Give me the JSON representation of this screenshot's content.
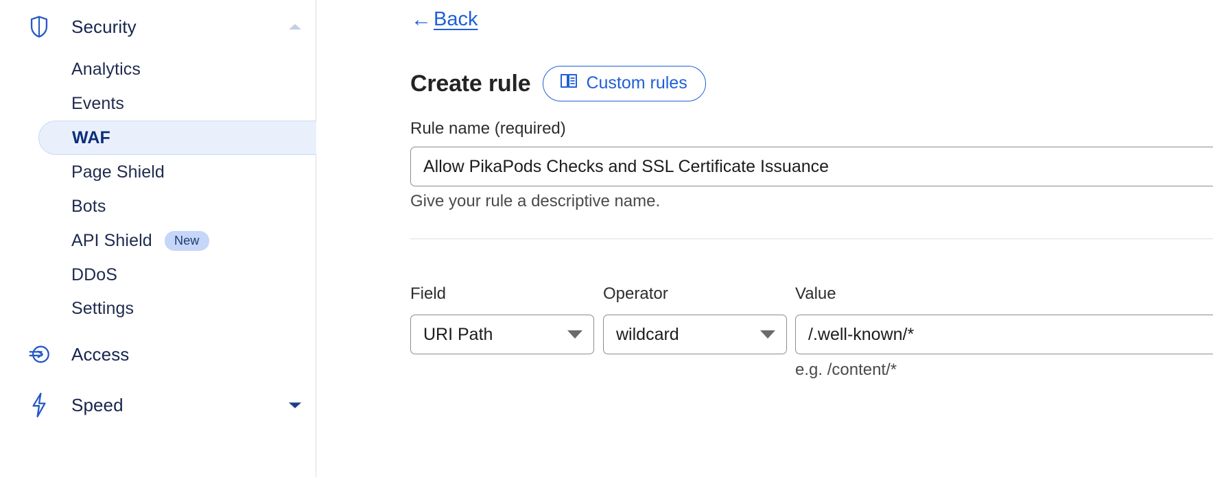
{
  "sidebar": {
    "groups": [
      {
        "label": "Security",
        "icon": "shield-icon",
        "chevron": "chevron-up-icon",
        "expanded": true,
        "items": [
          {
            "label": "Analytics",
            "active": false,
            "badge": null
          },
          {
            "label": "Events",
            "active": false,
            "badge": null
          },
          {
            "label": "WAF",
            "active": true,
            "badge": null
          },
          {
            "label": "Page Shield",
            "active": false,
            "badge": null
          },
          {
            "label": "Bots",
            "active": false,
            "badge": null
          },
          {
            "label": "API Shield",
            "active": false,
            "badge": "New"
          },
          {
            "label": "DDoS",
            "active": false,
            "badge": null
          },
          {
            "label": "Settings",
            "active": false,
            "badge": null
          }
        ]
      },
      {
        "label": "Access",
        "icon": "access-arrow-icon",
        "chevron": null,
        "expanded": false,
        "items": []
      },
      {
        "label": "Speed",
        "icon": "lightning-bolt-icon",
        "chevron": "chevron-down-icon",
        "expanded": false,
        "items": []
      }
    ]
  },
  "main": {
    "back_link": {
      "label": "Back",
      "icon": "arrow-left-icon"
    },
    "page_title": "Create rule",
    "docs_button": {
      "label": "Custom rules",
      "icon": "book-icon"
    },
    "rule_name": {
      "label": "Rule name (required)",
      "value": "Allow PikaPods Checks and SSL Certificate Issuance",
      "placeholder": "",
      "help": "Give your rule a descriptive name."
    },
    "expression": {
      "field": {
        "label": "Field",
        "value": "URI Path"
      },
      "operator": {
        "label": "Operator",
        "value": "wildcard"
      },
      "value": {
        "label": "Value",
        "value": "/.well-known/*",
        "help": "e.g. /content/*"
      }
    }
  },
  "colors": {
    "accent_blue": "#1f5fd8",
    "nav_text": "#16254e",
    "active_bg": "#eaf0fb",
    "badge_bg": "#c5d6f8"
  }
}
